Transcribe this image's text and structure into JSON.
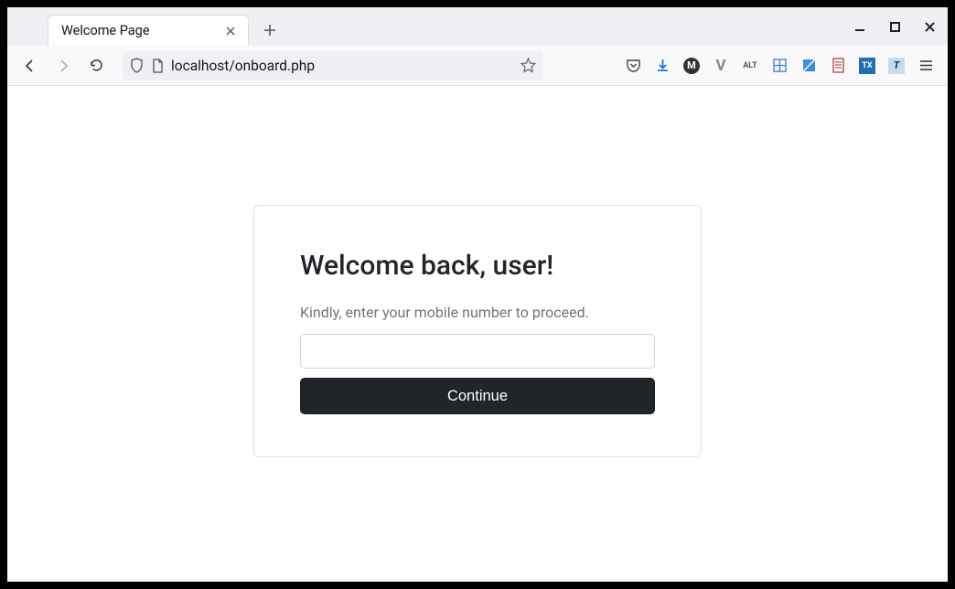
{
  "browser": {
    "tab_title": "Welcome Page",
    "url": "localhost/onboard.php"
  },
  "page": {
    "heading": "Welcome back, user!",
    "subtext": "Kindly, enter your mobile number to proceed.",
    "input_value": "",
    "continue_label": "Continue"
  }
}
